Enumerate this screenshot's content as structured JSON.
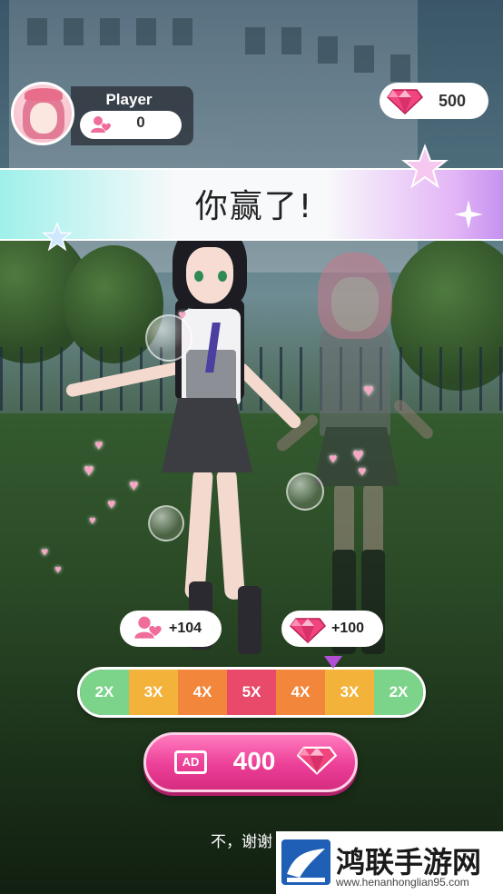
{
  "player": {
    "name": "Player",
    "likes": "0"
  },
  "gems": {
    "count": "500"
  },
  "banner": {
    "title": "你赢了!"
  },
  "rewards": {
    "likes_bonus": "+104",
    "gems_bonus": "+100"
  },
  "multipliers": [
    {
      "label": "2X",
      "color": "#7cd38a"
    },
    {
      "label": "3X",
      "color": "#f3b33b"
    },
    {
      "label": "4X",
      "color": "#f2873c"
    },
    {
      "label": "5X",
      "color": "#ea4a6a"
    },
    {
      "label": "4X",
      "color": "#f2873c"
    },
    {
      "label": "3X",
      "color": "#f3b33b"
    },
    {
      "label": "2X",
      "color": "#7cd38a"
    }
  ],
  "ad_button": {
    "badge": "AD",
    "value": "400"
  },
  "decline": {
    "label": "不，谢谢"
  },
  "watermark": {
    "name": "鸿联手游网",
    "url": "www.henanhonglian95.com"
  },
  "colors": {
    "accent_pink": "#ec3f97",
    "gem_pink": "#f0457f",
    "pointer": "#b14fd6"
  },
  "icons": [
    "likes-icon",
    "gem-icon",
    "star-icon",
    "heart-icon",
    "ad-icon"
  ]
}
